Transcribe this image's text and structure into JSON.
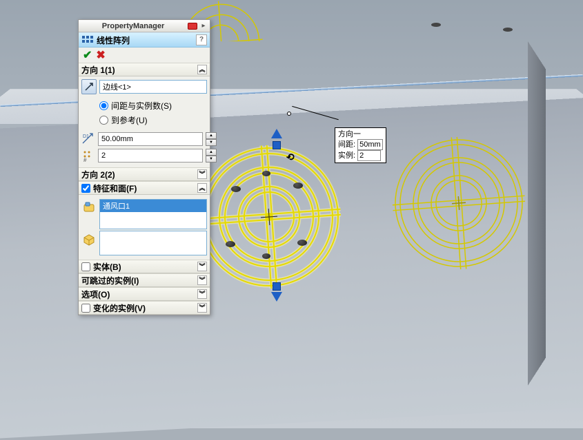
{
  "pm": {
    "title": "PropertyManager",
    "feature_name": "线性阵列",
    "help": "?",
    "dir1": {
      "title": "方向 1(1)",
      "edge": "边线<1>",
      "radio_spacing": "间距与实例数(S)",
      "radio_ref": "到参考(U)",
      "spacing": "50.00mm",
      "instances": "2"
    },
    "dir2": {
      "title": "方向 2(2)"
    },
    "features": {
      "title": "特征和面(F)",
      "item": "通风口1"
    },
    "bodies": {
      "title": "实体(B)"
    },
    "skip": {
      "title": "可跳过的实例(I)"
    },
    "options": {
      "title": "选项(O)"
    },
    "vary": {
      "title": "变化的实例(V)"
    }
  },
  "callout": {
    "title": "方向一",
    "spacing_label": "间距:",
    "spacing_value": "50mm",
    "inst_label": "实例:",
    "inst_value": "2"
  },
  "colors": {
    "select_yellow": "#e6da00",
    "accent_blue": "#3b8bd6"
  }
}
